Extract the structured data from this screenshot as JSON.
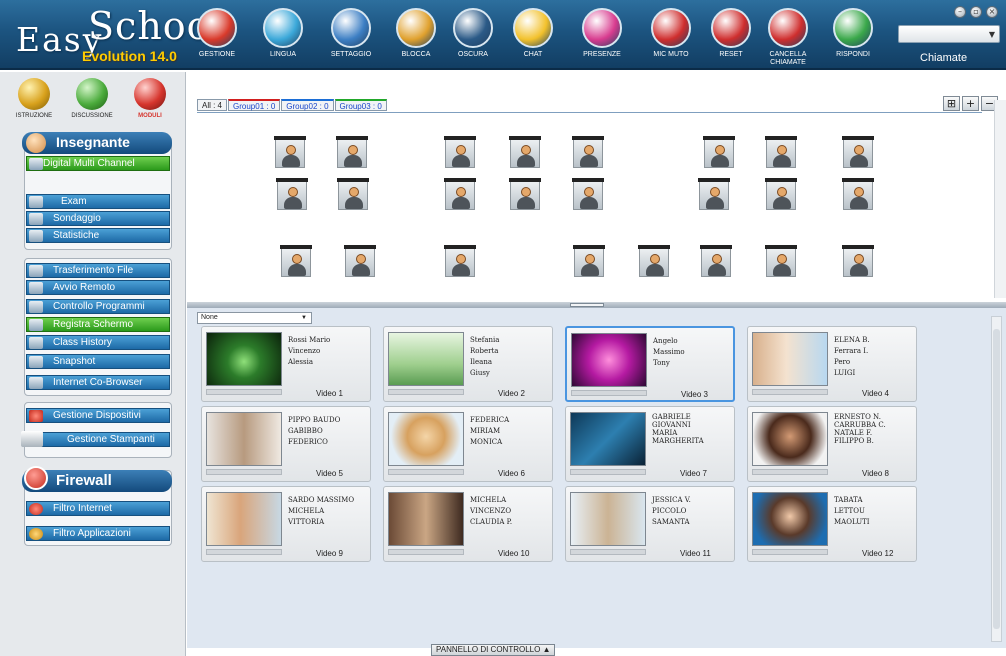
{
  "app": {
    "logo_line1": "Easy",
    "logo_line2": "School",
    "logo_version": "Evolution 14.0"
  },
  "toolbar": {
    "items": [
      {
        "label": "GESTIONE",
        "icon": "power-icon",
        "color": "#d93a2b"
      },
      {
        "label": "LINGUA",
        "icon": "globe-icon",
        "color": "#3ba8d9"
      },
      {
        "label": "SETTAGGIO",
        "icon": "wrench-icon",
        "color": "#3d7fc4"
      },
      {
        "label": "BLOCCA",
        "icon": "padlock-icon",
        "color": "#e0a12e"
      },
      {
        "label": "OSCURA",
        "icon": "screen-icon",
        "color": "#2b5a87"
      },
      {
        "label": "CHAT",
        "icon": "chat-bubble-icon",
        "color": "#f2c12c"
      },
      {
        "label": "PRESENZE",
        "icon": "attendance-icon",
        "color": "#d83c8f"
      },
      {
        "label": "MIC MUTO",
        "icon": "mic-mute-icon",
        "color": "#cf2e2e"
      },
      {
        "label": "RESET",
        "icon": "reset-icon",
        "color": "#cf2e2e"
      },
      {
        "label": "CANCELLA CHIAMATE",
        "icon": "cancel-call-icon",
        "color": "#cf2e2e"
      },
      {
        "label": "RISPONDI",
        "icon": "answer-call-icon",
        "color": "#3aa84a"
      }
    ],
    "calls_label": "Chiamate",
    "calls_select_value": ""
  },
  "sidebar": {
    "top_icons": [
      {
        "label": "ISTRUZIONE",
        "color": "#d8a11c"
      },
      {
        "label": "DISCUSSIONE",
        "color": "#4bab3c"
      },
      {
        "label": "MODULI",
        "color": "#d6352d"
      }
    ],
    "teacher_title": "Insegnante",
    "teacher_items": [
      {
        "label": "Digital Multi Channel",
        "active": true
      },
      {
        "label": "Exam",
        "active": false
      },
      {
        "label": "Sondaggio",
        "active": false
      },
      {
        "label": "Statistiche",
        "active": false
      }
    ],
    "tools_items": [
      {
        "label": "Trasferimento File",
        "active": false
      },
      {
        "label": "Avvio Remoto",
        "active": false
      },
      {
        "label": "Controllo Programmi",
        "active": false
      },
      {
        "label": "Registra Schermo",
        "active": true
      },
      {
        "label": "Class History",
        "active": false
      },
      {
        "label": "Snapshot",
        "active": false
      },
      {
        "label": "Internet Co-Browser",
        "active": false
      }
    ],
    "devices_items": [
      {
        "label": "Gestione Dispositivi"
      },
      {
        "label": "Gestione Stampanti"
      }
    ],
    "firewall_title": "Firewall",
    "firewall_items": [
      {
        "label": "Filtro Internet"
      },
      {
        "label": "Filtro Applicazioni"
      }
    ]
  },
  "classroom": {
    "tabs": [
      "All : 4",
      "Group01 : 0",
      "Group02 : 0",
      "Group03 : 0"
    ],
    "view_buttons": [
      "⊞",
      "+",
      "−"
    ],
    "student_count": 29
  },
  "video": {
    "filter_value": "None",
    "cards": [
      {
        "label": "Video 1",
        "names": [
          "Rossi Mario",
          "Vincenzo",
          "Alessia"
        ],
        "thumb": "stage-scene"
      },
      {
        "label": "Video 2",
        "names": [
          "Stefania",
          "Roberta",
          "Ileana",
          "Giusy"
        ],
        "thumb": "green-room"
      },
      {
        "label": "Video 3",
        "names": [
          "Angelo",
          "Massimo",
          "Tony"
        ],
        "thumb": "news-anchor",
        "selected": true
      },
      {
        "label": "Video 4",
        "names": [
          "ELENA B.",
          "Ferrara I.",
          "Pero",
          "LUIGI"
        ],
        "thumb": "couple"
      },
      {
        "label": "Video 5",
        "names": [
          "PIPPO BAUDO",
          "GABIBBO",
          "FEDERICO"
        ],
        "thumb": "office-meeting"
      },
      {
        "label": "Video 6",
        "names": [
          "FEDERICA",
          "MIRIAM",
          "MONICA"
        ],
        "thumb": "headset-operator"
      },
      {
        "label": "Video 7",
        "names": [
          "GABRIELE",
          "GIOVANNI",
          "MARIA",
          "MARGHERITA"
        ],
        "thumb": "computer-worker"
      },
      {
        "label": "Video 8",
        "names": [
          "ERNESTO N.",
          "CARRUBBA C.",
          "NATALE F.",
          "FILIPPO B."
        ],
        "thumb": "smiling-woman"
      },
      {
        "label": "Video 9",
        "names": [
          "SARDO MASSIMO",
          "MICHELA",
          "VITTORIA"
        ],
        "thumb": "family"
      },
      {
        "label": "Video 10",
        "names": [
          "MICHELA",
          "VINCENZO",
          "CLAUDIA P."
        ],
        "thumb": "group-portrait"
      },
      {
        "label": "Video 11",
        "names": [
          "JESSICA V.",
          "PICCOLO",
          "SAMANTA"
        ],
        "thumb": "students-desk"
      },
      {
        "label": "Video 12",
        "names": [
          "TABATA",
          "LETTOU",
          "MAOLUTI"
        ],
        "thumb": "businesswoman"
      }
    ]
  },
  "bottom": {
    "panel_label": "PANNELLO DI CONTROLLO",
    "panel_arrow": "▲"
  }
}
